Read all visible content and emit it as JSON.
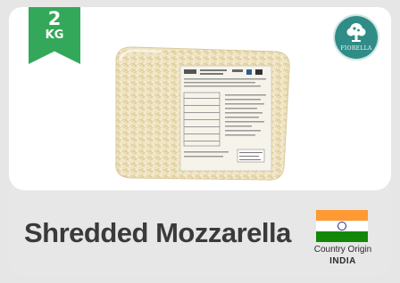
{
  "badge": {
    "weight": "2",
    "unit": "KG",
    "color": "#34a85a"
  },
  "brand": {
    "name": "FIORELLA",
    "color": "#2f8c86"
  },
  "product": {
    "title": "Shredded Mozzarella",
    "origin_label": "Country Origin",
    "origin_country": "INDIA",
    "flag_icon": "india-flag-icon"
  }
}
